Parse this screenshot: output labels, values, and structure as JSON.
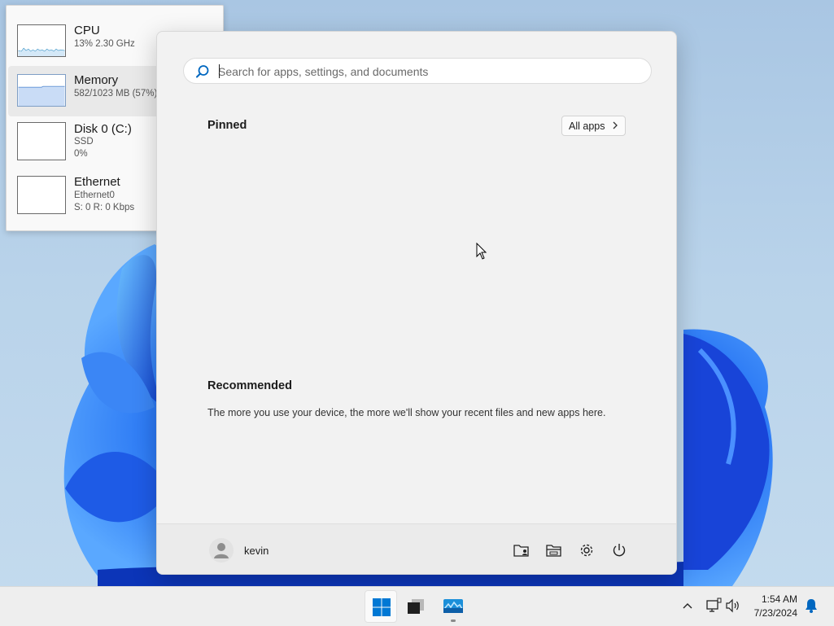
{
  "task_manager": {
    "items": [
      {
        "title": "CPU",
        "line1": "13%  2.30 GHz",
        "line2": ""
      },
      {
        "title": "Memory",
        "line1": "582/1023 MB (57%)",
        "line2": ""
      },
      {
        "title": "Disk 0 (C:)",
        "line1": "SSD",
        "line2": "0%"
      },
      {
        "title": "Ethernet",
        "line1": "Ethernet0",
        "line2": "S: 0 R: 0 Kbps"
      }
    ]
  },
  "start_menu": {
    "search_placeholder": "Search for apps, settings, and documents",
    "pinned_label": "Pinned",
    "all_apps_label": "All apps",
    "recommended_label": "Recommended",
    "recommended_text": "The more you use your device, the more we'll show your recent files and new apps here.",
    "user_name": "kevin"
  },
  "taskbar": {
    "time": "1:54 AM",
    "date": "7/23/2024"
  },
  "colors": {
    "accent": "#0067c0",
    "cpu_graph": "#117dbb",
    "memory_fill": "#c9dcf6"
  },
  "icons": [
    "search-icon",
    "chevron-right-icon",
    "user-avatar-icon",
    "documents-folder-icon",
    "file-explorer-icon",
    "gear-icon",
    "power-icon",
    "windows-logo-icon",
    "terminal-icon",
    "task-manager-icon",
    "chevron-up-icon",
    "network-icon",
    "volume-icon",
    "bell-icon"
  ]
}
